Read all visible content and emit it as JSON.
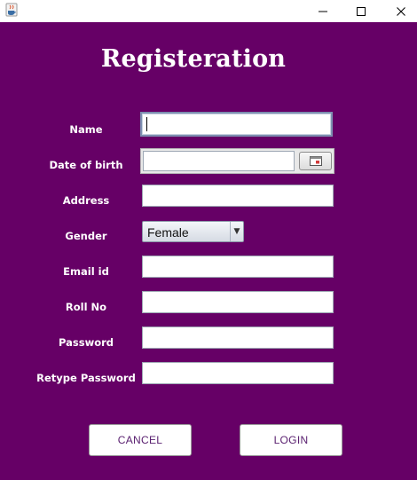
{
  "window": {
    "title": "",
    "app_icon": "java-cup-icon",
    "controls": [
      "minimize-icon",
      "maximize-icon",
      "close-icon"
    ]
  },
  "colors": {
    "background": "#660066",
    "label_text": "#ffffff",
    "button_text": "#5a2070"
  },
  "form": {
    "heading": "Registeration",
    "fields": {
      "name": {
        "label": "Name",
        "value": ""
      },
      "dob": {
        "label": "Date of birth",
        "value": "",
        "picker_icon": "calendar-icon"
      },
      "address": {
        "label": "Address",
        "value": ""
      },
      "gender": {
        "label": "Gender",
        "selected": "Female"
      },
      "email": {
        "label": "Email id",
        "value": ""
      },
      "roll_no": {
        "label": "Roll No",
        "value": ""
      },
      "password": {
        "label": "Password",
        "value": ""
      },
      "retype_password": {
        "label": "Retype Password",
        "value": ""
      }
    },
    "buttons": {
      "cancel": "CANCEL",
      "login": "LOGIN"
    }
  }
}
